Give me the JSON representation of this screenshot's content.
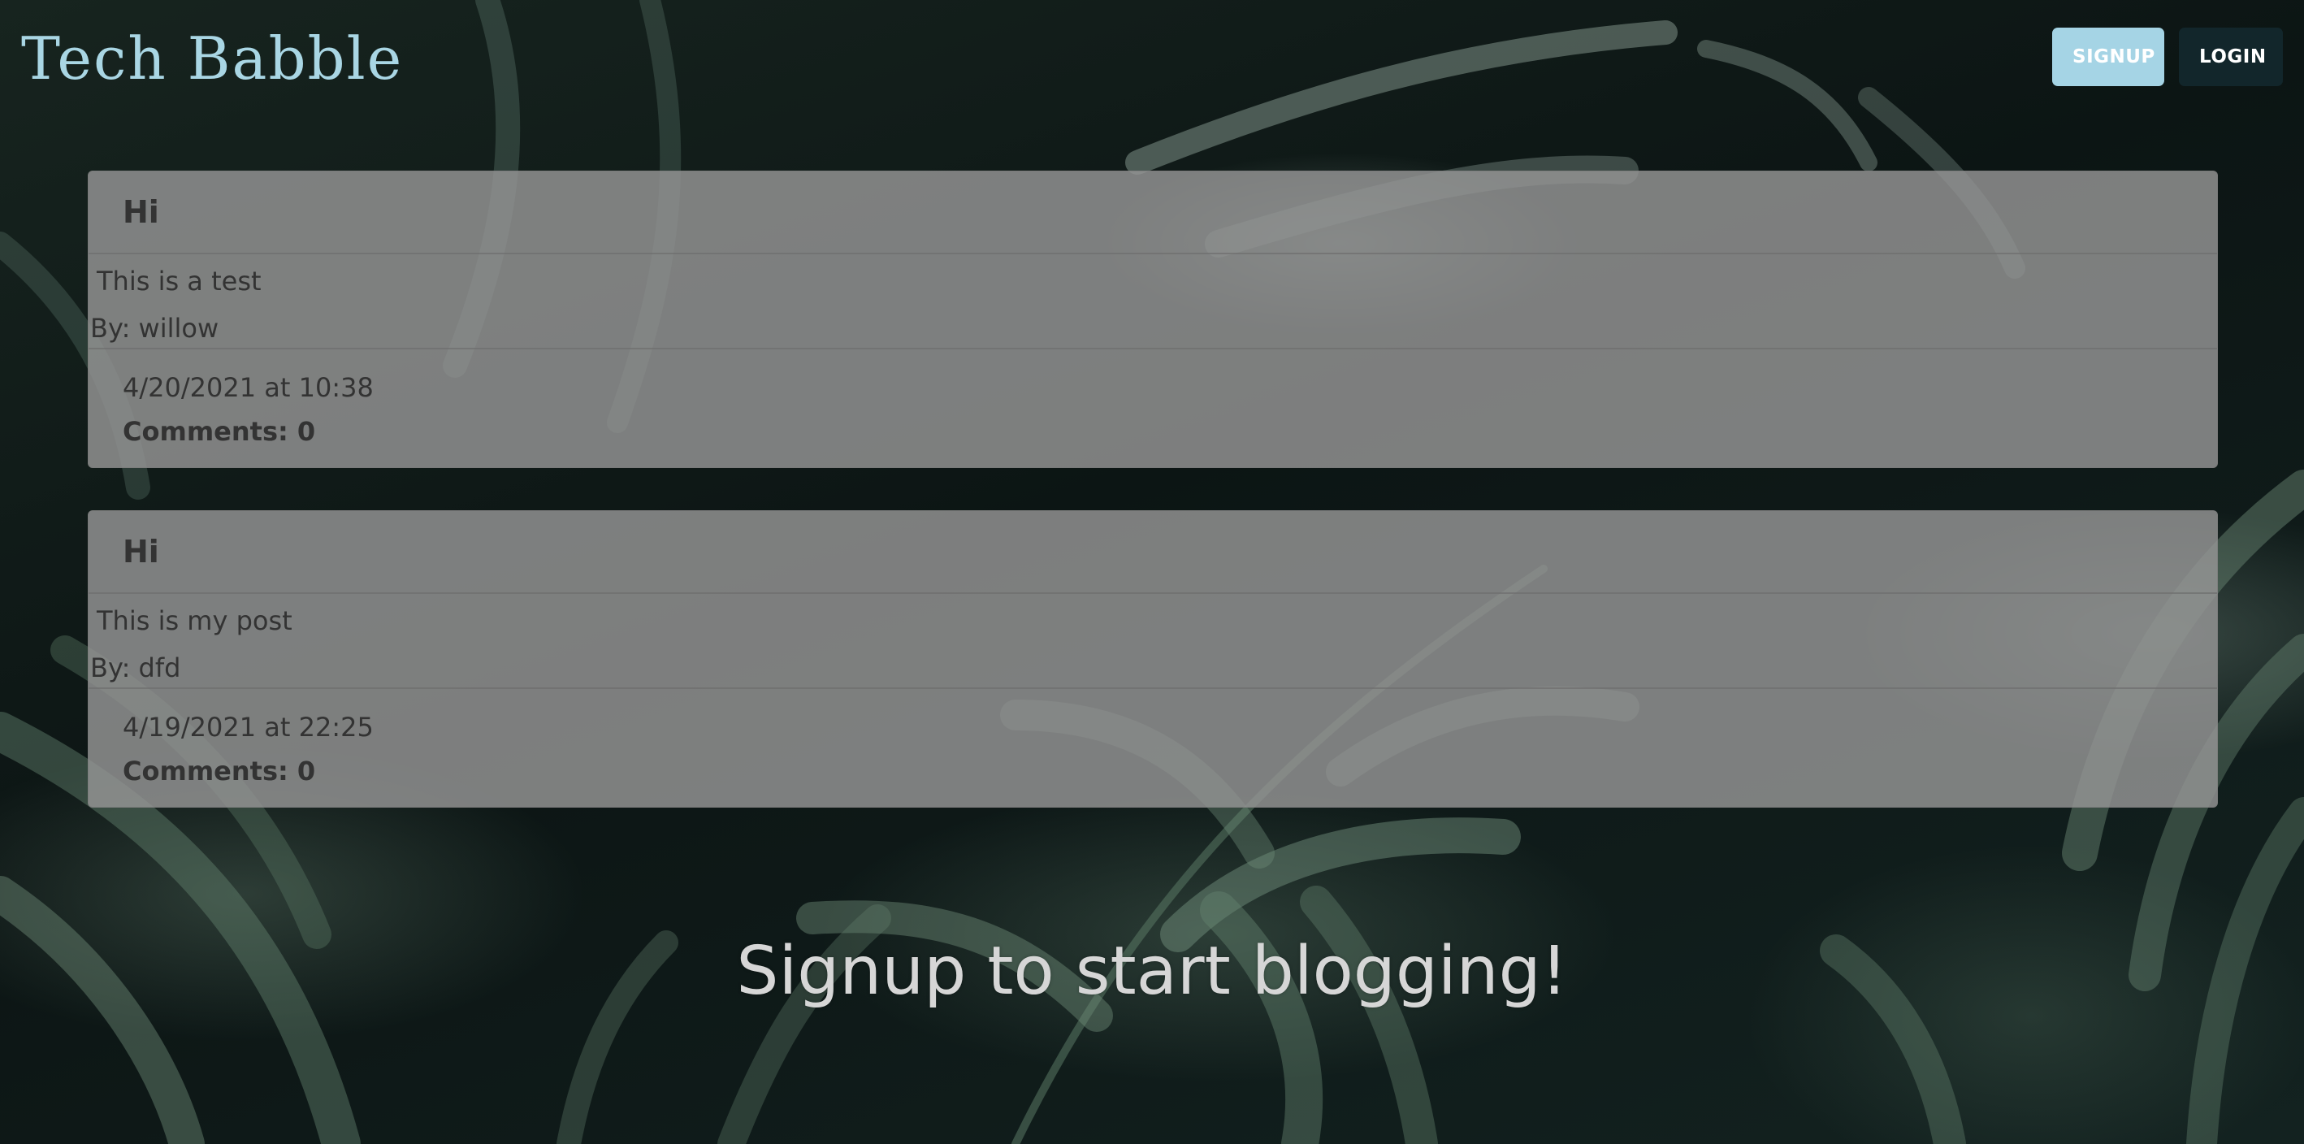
{
  "header": {
    "site_title": "Tech Babble",
    "signup_label": "SIGNUP",
    "login_label": "LOGIN"
  },
  "posts": [
    {
      "title": "Hi",
      "content": "This is a test",
      "author": "By: willow",
      "date": "4/20/2021 at 10:38",
      "comments": "Comments: 0"
    },
    {
      "title": "Hi",
      "content": "This is my post",
      "author": "By: dfd",
      "date": "4/19/2021 at 22:25",
      "comments": "Comments: 0"
    }
  ],
  "cta": {
    "text": "Signup to start blogging!"
  },
  "colors": {
    "title": "#a9d6e4",
    "signup_button": "#a5d4e5",
    "login_button": "#12262b",
    "card_background": "#969696"
  }
}
